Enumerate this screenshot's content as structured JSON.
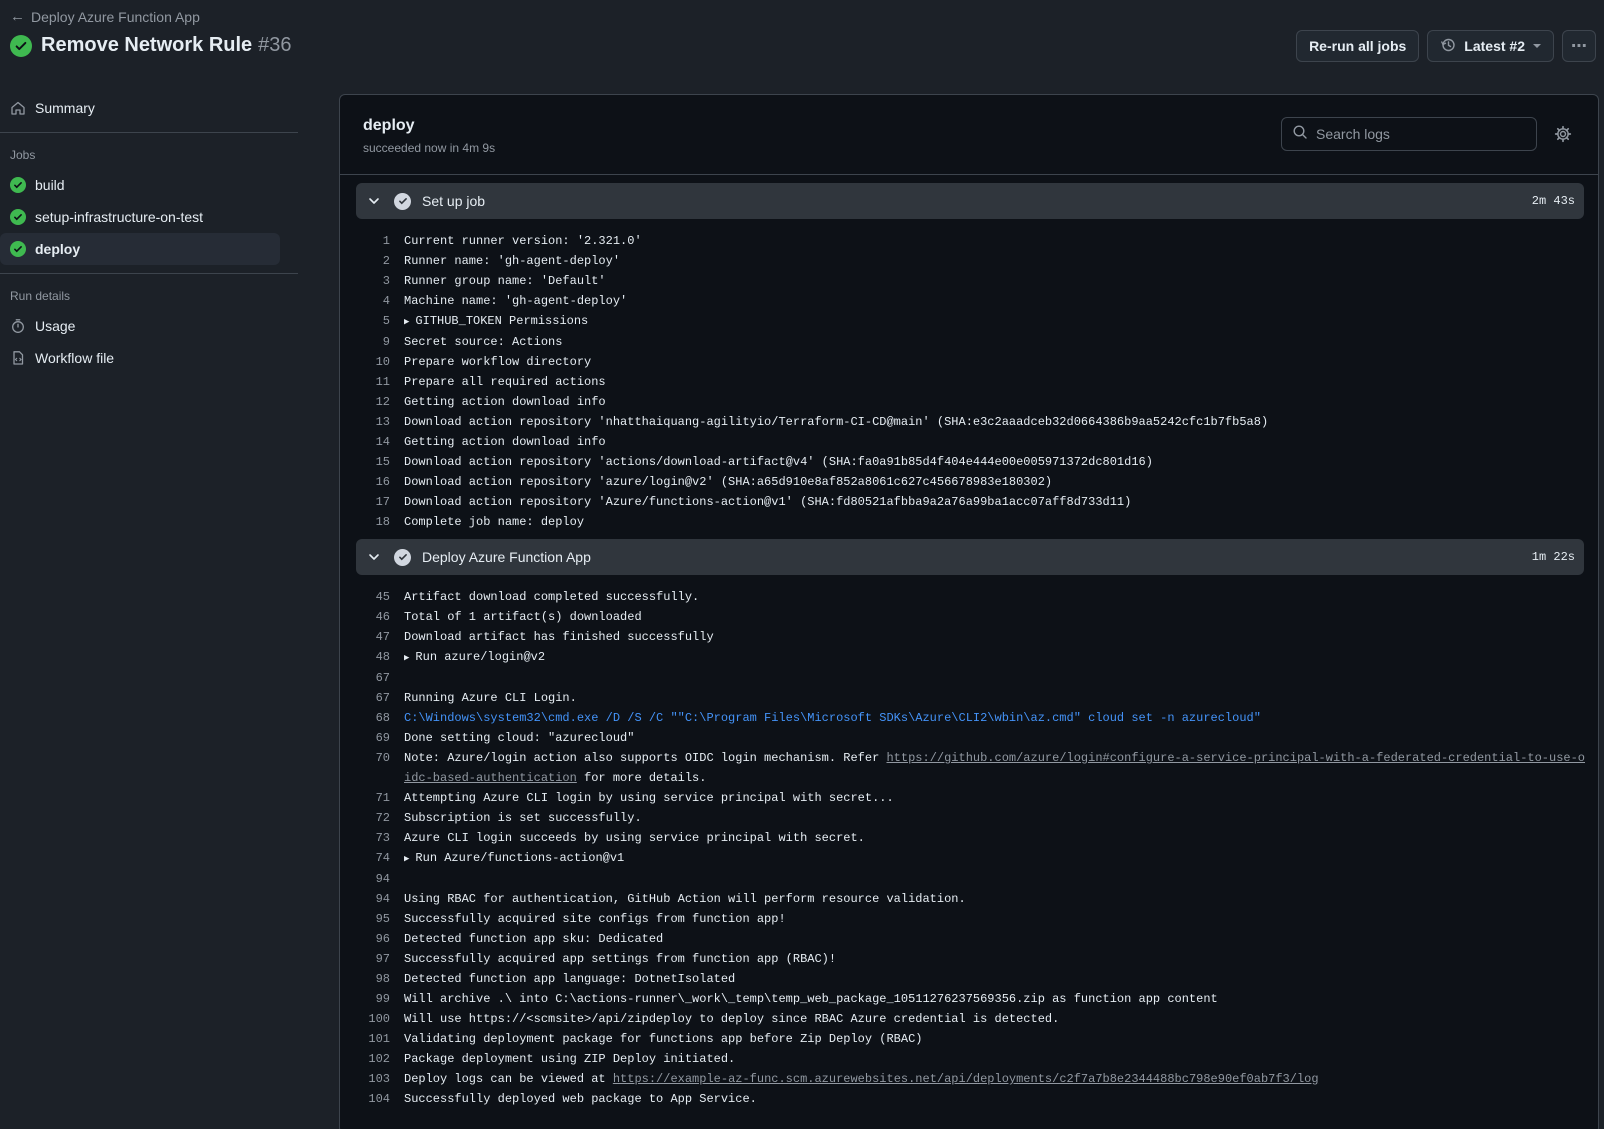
{
  "header": {
    "back_label": "Deploy Azure Function App",
    "title": "Remove Network Rule",
    "run_number": "#36",
    "rerun_label": "Re-run all jobs",
    "latest_label": "Latest #2",
    "more_glyph": "⋯"
  },
  "sidebar": {
    "summary_label": "Summary",
    "jobs_heading": "Jobs",
    "jobs": [
      {
        "label": "build"
      },
      {
        "label": "setup-infrastructure-on-test"
      },
      {
        "label": "deploy"
      }
    ],
    "run_details_heading": "Run details",
    "usage_label": "Usage",
    "workflow_file_label": "Workflow file"
  },
  "job": {
    "name": "deploy",
    "status": "succeeded now in 4m 9s",
    "search_placeholder": "Search logs"
  },
  "steps": [
    {
      "name": "Set up job",
      "duration": "2m 43s",
      "lines": [
        {
          "n": "1",
          "t": "Current runner version: '2.321.0'"
        },
        {
          "n": "2",
          "t": "Runner name: 'gh-agent-deploy'"
        },
        {
          "n": "3",
          "t": "Runner group name: 'Default'"
        },
        {
          "n": "4",
          "t": "Machine name: 'gh-agent-deploy'"
        },
        {
          "n": "5",
          "t": "GITHUB_TOKEN Permissions"
        },
        {
          "n": "9",
          "t": "Secret source: Actions"
        },
        {
          "n": "10",
          "t": "Prepare workflow directory"
        },
        {
          "n": "11",
          "t": "Prepare all required actions"
        },
        {
          "n": "12",
          "t": "Getting action download info"
        },
        {
          "n": "13",
          "t": "Download action repository 'nhatthaiquang-agilityio/Terraform-CI-CD@main' (SHA:e3c2aaadceb32d0664386b9aa5242cfc1b7fb5a8)"
        },
        {
          "n": "14",
          "t": "Getting action download info"
        },
        {
          "n": "15",
          "t": "Download action repository 'actions/download-artifact@v4' (SHA:fa0a91b85d4f404e444e00e005971372dc801d16)"
        },
        {
          "n": "16",
          "t": "Download action repository 'azure/login@v2' (SHA:a65d910e8af852a8061c627c456678983e180302)"
        },
        {
          "n": "17",
          "t": "Download action repository 'Azure/functions-action@v1' (SHA:fd80521afbba9a2a76a99ba1acc07aff8d733d11)"
        },
        {
          "n": "18",
          "t": "Complete job name: deploy"
        }
      ]
    },
    {
      "name": "Deploy Azure Function App",
      "duration": "1m 22s",
      "lines": [
        {
          "n": "45",
          "t": "Artifact download completed successfully."
        },
        {
          "n": "46",
          "t": "Total of 1 artifact(s) downloaded"
        },
        {
          "n": "47",
          "t": "Download artifact has finished successfully"
        },
        {
          "n": "48",
          "t": "Run azure/login@v2"
        },
        {
          "n": "67",
          "t": ""
        },
        {
          "n": "67",
          "t": "Running Azure CLI Login."
        },
        {
          "n": "68",
          "t": "C:\\Windows\\system32\\cmd.exe /D /S /C \"\"C:\\Program Files\\Microsoft SDKs\\Azure\\CLI2\\wbin\\az.cmd\" cloud set -n azurecloud\""
        },
        {
          "n": "69",
          "t": "Done setting cloud: \"azurecloud\""
        },
        {
          "n": "70",
          "t": "Note: Azure/login action also supports OIDC login mechanism. Refer ",
          "link": "https://github.com/azure/login#configure-a-service-principal-with-a-federated-credential-to-use-oidc-based-authentication",
          "after": " for more details."
        },
        {
          "n": "71",
          "t": "Attempting Azure CLI login by using service principal with secret..."
        },
        {
          "n": "72",
          "t": "Subscription is set successfully."
        },
        {
          "n": "73",
          "t": "Azure CLI login succeeds by using service principal with secret."
        },
        {
          "n": "74",
          "t": "Run Azure/functions-action@v1"
        },
        {
          "n": "94",
          "t": ""
        },
        {
          "n": "94",
          "t": "Using RBAC for authentication, GitHub Action will perform resource validation."
        },
        {
          "n": "95",
          "t": "Successfully acquired site configs from function app!"
        },
        {
          "n": "96",
          "t": "Detected function app sku: Dedicated"
        },
        {
          "n": "97",
          "t": "Successfully acquired app settings from function app (RBAC)!"
        },
        {
          "n": "98",
          "t": "Detected function app language: DotnetIsolated"
        },
        {
          "n": "99",
          "t": "Will archive .\\ into C:\\actions-runner\\_work\\_temp\\temp_web_package_10511276237569356.zip as function app content"
        },
        {
          "n": "100",
          "t": "Will use https://<scmsite>/api/zipdeploy to deploy since RBAC Azure credential is detected."
        },
        {
          "n": "101",
          "t": "Validating deployment package for functions app before Zip Deploy (RBAC)"
        },
        {
          "n": "102",
          "t": "Package deployment using ZIP Deploy initiated."
        },
        {
          "n": "103",
          "t": "Deploy logs can be viewed at ",
          "link": "https://example-az-func.scm.azurewebsites.net/api/deployments/c2f7a7b8e2344488bc798e90ef0ab7f3/log",
          "after": ""
        },
        {
          "n": "104",
          "t": "Successfully deployed web package to App Service."
        }
      ]
    }
  ],
  "colors": {
    "success": "#3fb950",
    "link": "#4493f8",
    "bg": "#0d1117",
    "step_header": "#30363d"
  }
}
